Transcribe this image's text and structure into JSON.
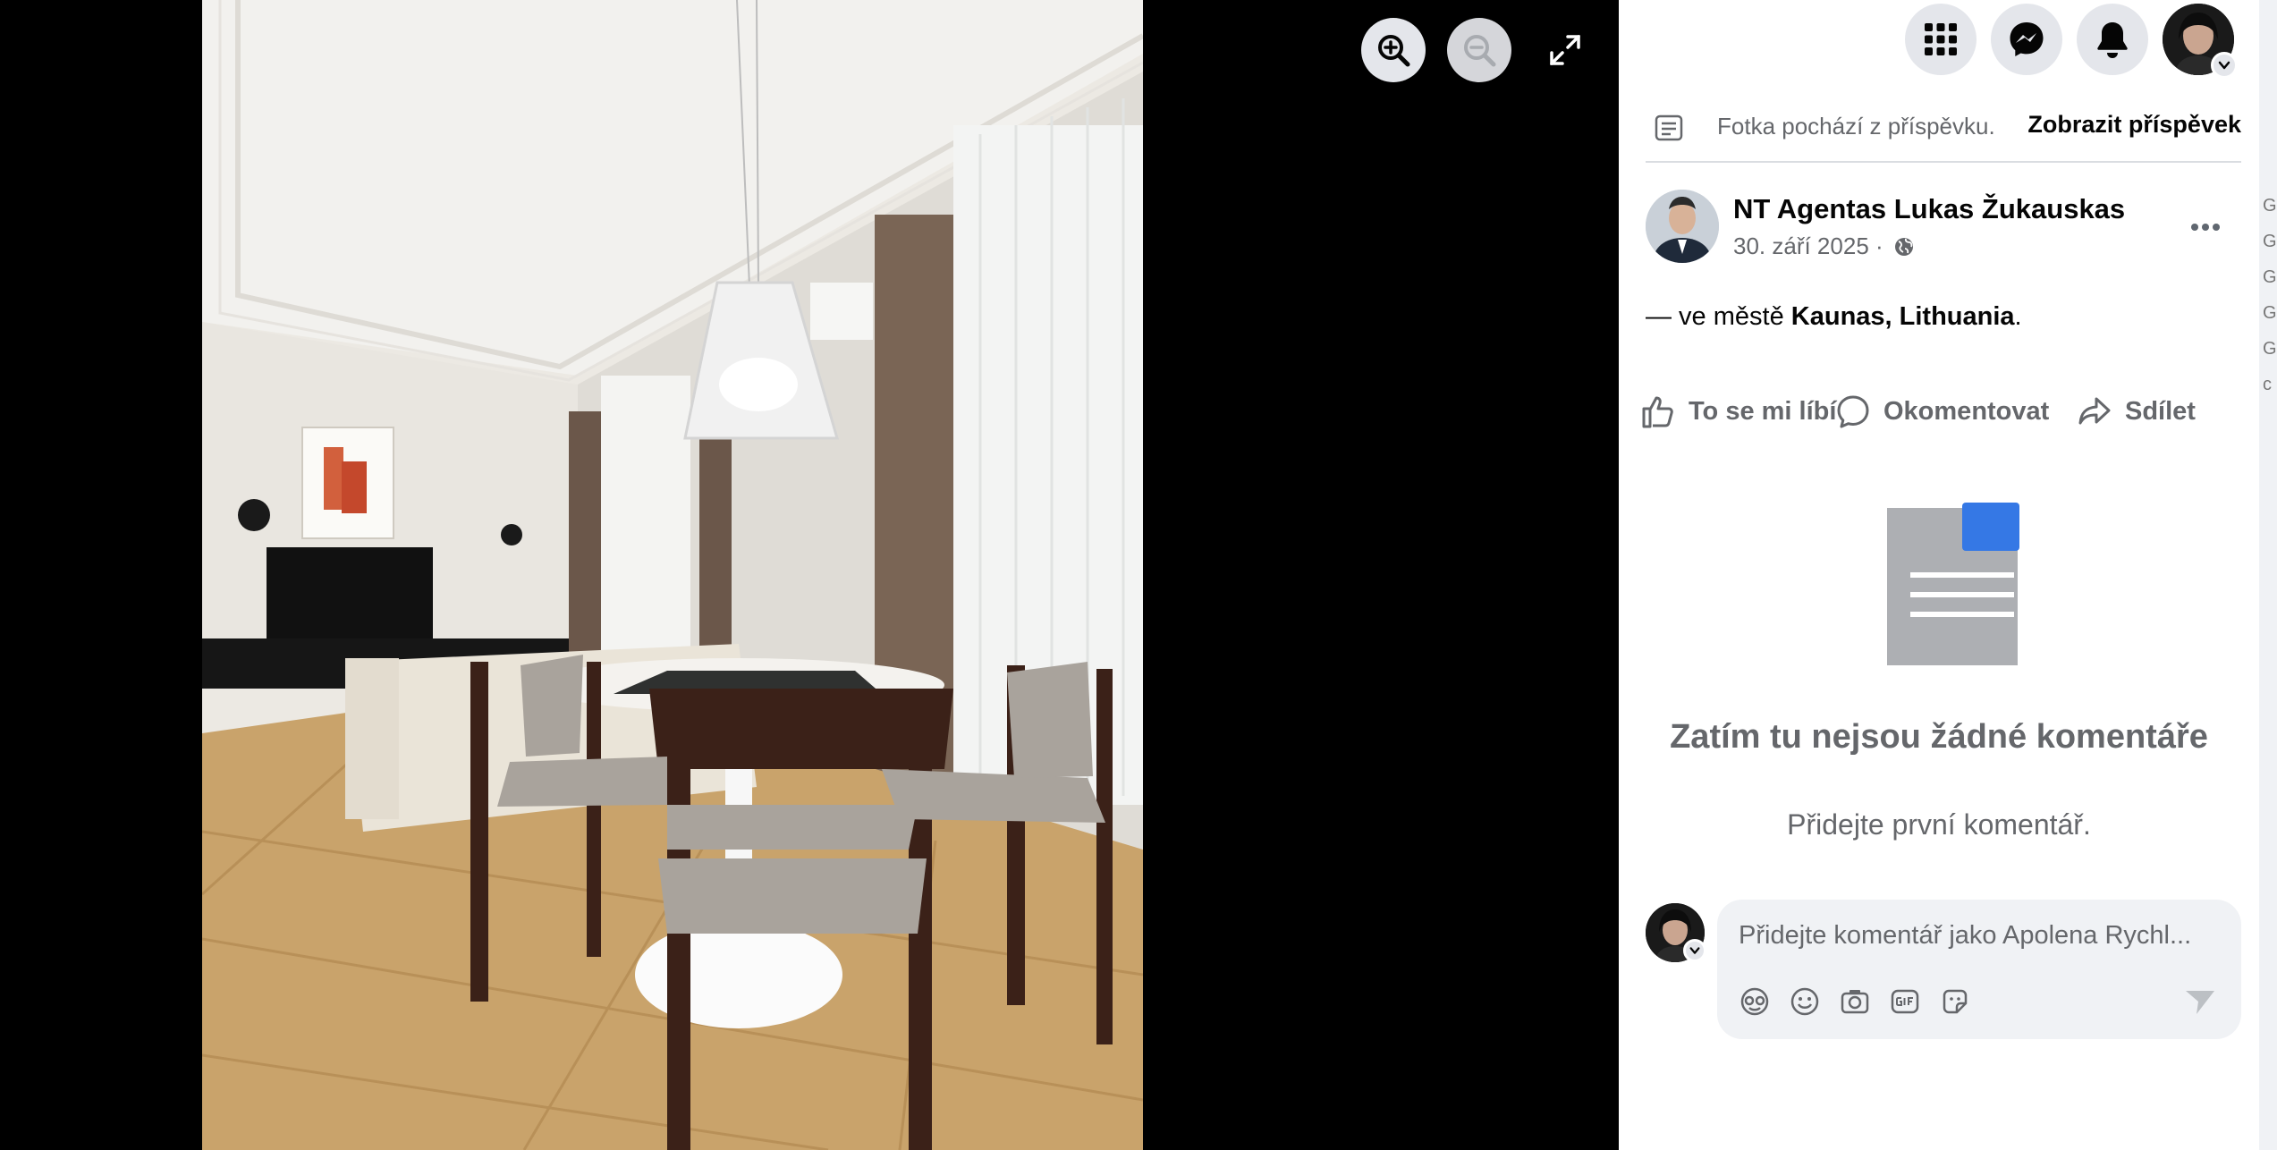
{
  "viewer": {
    "zoom_in_icon": "zoom-in-icon",
    "zoom_out_icon": "zoom-out-icon",
    "fullscreen_icon": "expand-icon"
  },
  "topbar": {
    "menu_icon": "grid-menu-icon",
    "messenger_icon": "messenger-icon",
    "notifications_icon": "bell-icon",
    "account_icon": "avatar"
  },
  "post": {
    "origin_text": "Fotka pochází z příspěvku.",
    "view_post_label": "Zobrazit příspěvek",
    "author_name": "NT Agentas Lukas Žukauskas",
    "date": "30. září 2025 ·",
    "location_prefix": "— ve městě ",
    "location_name": "Kaunas, Lithuania",
    "location_suffix": "."
  },
  "actions": {
    "like_label": "To se mi líbí",
    "comment_label": "Okomentovat",
    "share_label": "Sdílet"
  },
  "comments": {
    "empty_title": "Zatím tu nejsou žádné komentáře",
    "empty_subtitle": "Přidejte první komentář.",
    "input_placeholder": "Přidejte komentář jako Apolena Rychl..."
  },
  "colors": {
    "accent": "#3578e5",
    "muted_text": "#65676b",
    "primary_text": "#050505",
    "button_bg": "#e4e6eb"
  }
}
